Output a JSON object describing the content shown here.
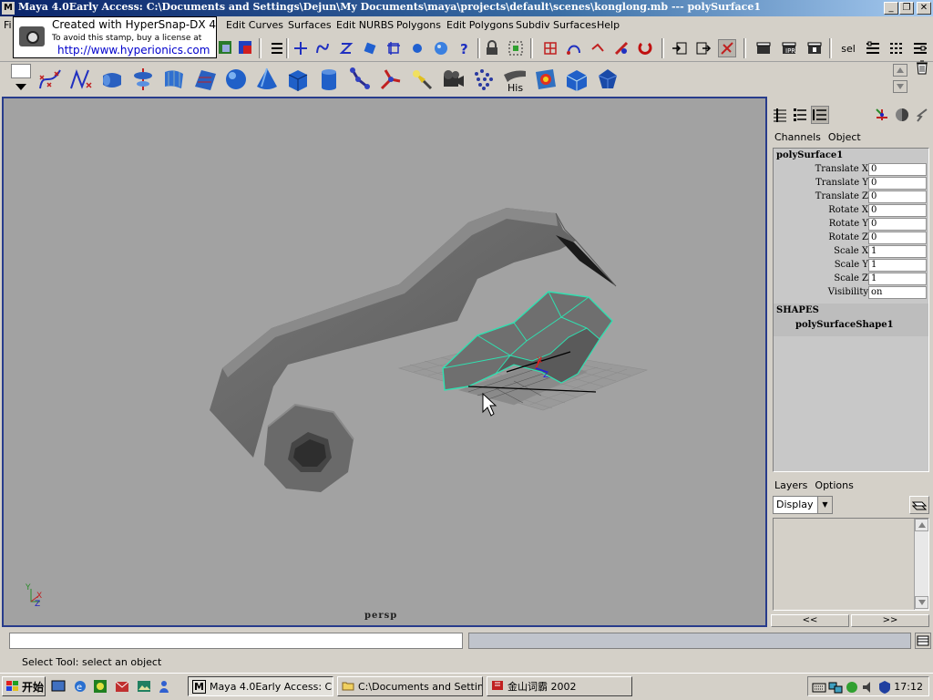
{
  "window": {
    "title": "Maya 4.0Early Access: C:\\Documents and Settings\\Dejun\\My Documents\\maya\\projects\\default\\scenes\\konglong.mb  ---  polySurface1",
    "app_icon": "M"
  },
  "stamp": {
    "line1": "Created with HyperSnap-DX 4",
    "line2": "To avoid this stamp, buy a license at",
    "line3": "http://www.hyperionics.com"
  },
  "menubar": {
    "file_stub": "Fi",
    "items": [
      "Edit Curves",
      "Surfaces",
      "Edit NURBS",
      "Polygons",
      "Edit Polygons",
      "Subdiv Surfaces",
      "Help"
    ]
  },
  "statusline": {
    "sel_label": "sel"
  },
  "shelf": {
    "history_label": "His"
  },
  "viewport": {
    "camera_label": "persp",
    "axis_x": "X",
    "axis_y": "Y",
    "axis_z": "Z"
  },
  "channel_box": {
    "tabs": [
      "Channels",
      "Object"
    ],
    "object_name": "polySurface1",
    "channels": [
      {
        "label": "Translate X",
        "value": "0"
      },
      {
        "label": "Translate Y",
        "value": "0"
      },
      {
        "label": "Translate Z",
        "value": "0"
      },
      {
        "label": "Rotate X",
        "value": "0"
      },
      {
        "label": "Rotate Y",
        "value": "0"
      },
      {
        "label": "Rotate Z",
        "value": "0"
      },
      {
        "label": "Scale X",
        "value": "1"
      },
      {
        "label": "Scale Y",
        "value": "1"
      },
      {
        "label": "Scale Z",
        "value": "1"
      },
      {
        "label": "Visibility",
        "value": "on"
      }
    ],
    "shapes_header": "SHAPES",
    "shape_name": "polySurfaceShape1"
  },
  "layers": {
    "tabs": [
      "Layers",
      "Options"
    ],
    "display_option": "Display",
    "prev_label": "<<",
    "next_label": ">>"
  },
  "help_line": "Select Tool: select an object",
  "taskbar": {
    "start_label": "开始",
    "tasks": [
      {
        "label": "Maya 4.0Early Access: C...",
        "active": true
      },
      {
        "label": "C:\\Documents and Settin...",
        "active": false
      },
      {
        "label": "金山词霸 2002",
        "active": false
      }
    ],
    "clock": "17:12"
  },
  "colors": {
    "viewport_bg": "#a2a2a2",
    "selection_highlight": "#30e0b0",
    "title_gradient_start": "#0a246a"
  }
}
